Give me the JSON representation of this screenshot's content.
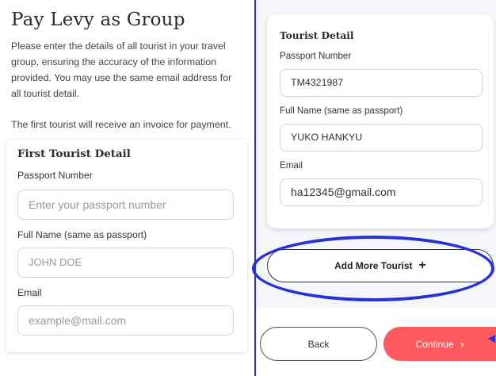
{
  "left": {
    "title": "Pay Levy as Group",
    "intro": "Please enter the details of all tourist in your travel group, ensuring the accuracy of the information provided. You may use the same email address for all tourist detail.",
    "note": "The first tourist will receive an invoice for payment.",
    "card": {
      "title": "First Tourist Detail",
      "passport_label": "Passport Number",
      "passport_placeholder": "Enter your passport number",
      "name_label": "Full Name (same as passport)",
      "name_placeholder": "JOHN DOE",
      "email_label": "Email",
      "email_placeholder": "example@mail.com"
    }
  },
  "right": {
    "card": {
      "title": "Tourist Detail",
      "passport_label": "Passport Number",
      "passport_value": "TM4321987",
      "name_label": "Full Name (same as passport)",
      "name_value": "YUKO HANKYU",
      "email_label": "Email",
      "email_value": "ha12345@gmail.com"
    },
    "add_more_label": "Add More Tourist",
    "add_more_icon": "+",
    "back_label": "Back",
    "continue_label": "Continue",
    "continue_icon": "›"
  },
  "colors": {
    "accent_blue": "#2632d8",
    "continue_red": "#ff5a5f"
  }
}
